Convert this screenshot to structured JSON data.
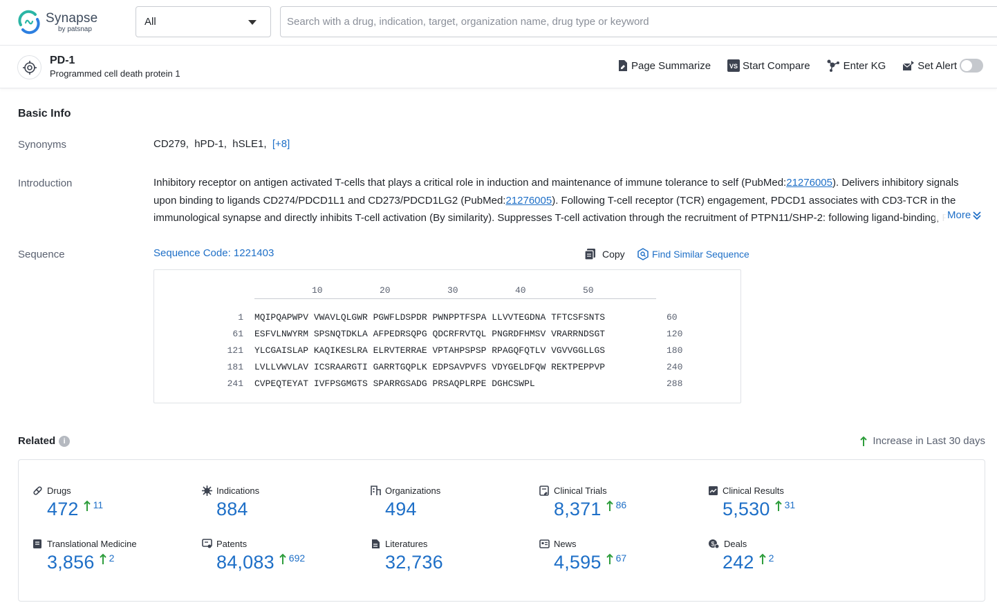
{
  "brand": {
    "name": "Synapse",
    "sub": "by patsnap"
  },
  "search": {
    "scope": "All",
    "placeholder": "Search with a drug, indication, target, organization name, drug type or keyword"
  },
  "entity": {
    "name": "PD-1",
    "full_name": "Programmed cell death protein 1",
    "actions": {
      "summarize": "Page Summarize",
      "compare": "Start Compare",
      "kg": "Enter KG",
      "alert": "Set Alert"
    }
  },
  "basic_info": {
    "title": "Basic Info",
    "synonyms_label": "Synonyms",
    "synonyms": [
      "CD279",
      "hPD-1",
      "hSLE1"
    ],
    "synonyms_more": "[+8]",
    "intro_label": "Introduction",
    "intro": {
      "p1": "Inhibitory receptor on antigen activated T-cells that plays a critical role in induction and maintenance of immune tolerance to self (PubMed:",
      "link1": "21276005",
      "p2": "). Delivers inhibitory signals upon binding to ligands CD274/PDCD1L1 and CD273/PDCD1LG2 (PubMed:",
      "link2": "21276005",
      "p3": "). Following T-cell receptor (TCR) engagement, PDCD1 associates with CD3-TCR in the immunological synapse and directly inhibits T-cell activation (By similarity). Suppresses T-cell activation through the recruitment of PTPN11/SHP-2: following ligand-binding, PD"
    },
    "intro_more": "More",
    "sequence_label": "Sequence",
    "sequence_code": "Sequence Code: 1221403",
    "copy": "Copy",
    "find_similar": "Find Similar Sequence",
    "ruler": [
      "10",
      "20",
      "30",
      "40",
      "50"
    ],
    "rows": [
      {
        "start": "1",
        "residues": "MQIPQAPWPV VWAVLQLGWR PGWFLDSPDR PWNPPTFSPA LLVVTEGDNA TFTCSFSNTS",
        "end": "60"
      },
      {
        "start": "61",
        "residues": "ESFVLNWYRM SPSNQTDKLA AFPEDRSQPG QDCRFRVTQL PNGRDFHMSV VRARRNDSGT",
        "end": "120"
      },
      {
        "start": "121",
        "residues": "YLCGAISLAP KAQIKESLRA ELRVTERRAE VPTAHPSPSP RPAGQFQTLV VGVVGGLLGS",
        "end": "180"
      },
      {
        "start": "181",
        "residues": "LVLLVWVLAV ICSRAARGTI GARRTGQPLK EDPSAVPVFS VDYGELDFQW REKTPEPPVP",
        "end": "240"
      },
      {
        "start": "241",
        "residues": "CVPEQTEYAT IVFPSGMGTS SPARRGSADG PRSAQPLRPE DGHCSWPL",
        "end": "288"
      }
    ]
  },
  "related": {
    "title": "Related",
    "legend": "Increase in Last 30 days",
    "accent": "#1e6fc7",
    "increase_color": "#2e9d3c",
    "stats": [
      {
        "label": "Drugs",
        "icon": "pill-icon",
        "value": "472",
        "inc": "11"
      },
      {
        "label": "Indications",
        "icon": "virus-icon",
        "value": "884",
        "inc": ""
      },
      {
        "label": "Organizations",
        "icon": "building-icon",
        "value": "494",
        "inc": ""
      },
      {
        "label": "Clinical Trials",
        "icon": "clipboard-icon",
        "value": "8,371",
        "inc": "86"
      },
      {
        "label": "Clinical Results",
        "icon": "report-icon",
        "value": "5,530",
        "inc": "31"
      },
      {
        "label": "Translational Medicine",
        "icon": "book-icon",
        "value": "3,856",
        "inc": "2"
      },
      {
        "label": "Patents",
        "icon": "patent-icon",
        "value": "84,083",
        "inc": "692"
      },
      {
        "label": "Literatures",
        "icon": "document-icon",
        "value": "32,736",
        "inc": ""
      },
      {
        "label": "News",
        "icon": "newspaper-icon",
        "value": "4,595",
        "inc": "67"
      },
      {
        "label": "Deals",
        "icon": "handshake-icon",
        "value": "242",
        "inc": "2"
      }
    ]
  }
}
